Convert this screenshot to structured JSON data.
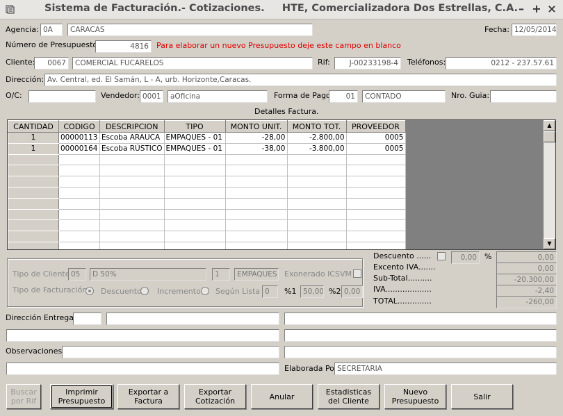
{
  "window": {
    "title": "Sistema de Facturación.- Cotizaciones.     HTE, Comercializadora Dos Estrellas, C.A.",
    "minimize": "–",
    "maximize": "+",
    "close": "×"
  },
  "header": {
    "agencia_label": "Agencia:",
    "agencia_code": "0A",
    "agencia_name": "CARACAS",
    "fecha_label": "Fecha:",
    "fecha": "12/05/2014",
    "presupuesto_label": "Número de Presupuesto:",
    "presupuesto": "4816",
    "presupuesto_hint": "Para elaborar un nuevo Presupuesto deje este campo en blanco",
    "cliente_label": "Cliente:",
    "cliente_code": "0067",
    "cliente_name": "COMERCIAL FUCARELOS",
    "rif_label": "Rif:",
    "rif": "J-00233198-4",
    "telefonos_label": "Teléfonos:",
    "telefonos": "0212 - 237.57.61",
    "direccion_label": "Dirección:",
    "direccion": "Av. Central, ed. El Samán, L - A, urb. Horizonte,Caracas.",
    "oc_label": "O/C:",
    "oc": "",
    "vendedor_label": "Vendedor:",
    "vendedor_code": "0001",
    "vendedor_name": "aOficina",
    "forma_pago_label": "Forma de Pago:",
    "forma_pago_code": "01",
    "forma_pago_name": "CONTADO",
    "nro_guia_label": "Nro. Guia:",
    "nro_guia": ""
  },
  "details": {
    "caption": "Detalles Factura.",
    "columns": [
      "CANTIDAD",
      "CODIGO",
      "DESCRIPCION",
      "TIPO",
      "MONTO UNIT.",
      "MONTO TOT.",
      "PROVEEDOR"
    ],
    "rows": [
      [
        "1",
        "00000113",
        "Escoba ARAUCA",
        "EMPAQUES - 01",
        "-28,00",
        "-2.800,00",
        "0005"
      ],
      [
        "1",
        "00000164",
        "Escoba RÚSTICO",
        "EMPAQUES - 01",
        "-38,00",
        "-3.800,00",
        "0005"
      ]
    ]
  },
  "tipo": {
    "tipo_cliente_label": "Tipo de Cliente:",
    "tipo_cliente_code": "05",
    "tipo_cliente_name": "D 50%",
    "tipo_code2": "1",
    "tipo_name2": "EMPAQUES",
    "exonerado_label": "Exonerado ICSVM",
    "tipo_fact_label": "Tipo de Facturación:",
    "descuento_label": "Descuento",
    "incremento_label": "Incremento",
    "segun_lista_label": "Según Lista",
    "segun_lista_value": "0",
    "pct1_label": "%1",
    "pct1": "50,00",
    "pct2_label": "%2",
    "pct2": "0,00"
  },
  "totals": {
    "descuento_label": "Descuento ......",
    "descuento_pct": "0,00",
    "pct_sign": "%",
    "descuento": "0,00",
    "excento_label": "Excento IVA.......",
    "excento": "0,00",
    "subtotal_label": "Sub-Total..........",
    "subtotal": "-20.300,00",
    "iva_label": "IVA...................",
    "iva": "-2,40",
    "total_label": "TOTAL..............",
    "total": "-260,00"
  },
  "footer": {
    "direccion_entrega_label": "Dirección Entrega:",
    "observaciones_label": "Observaciones:",
    "elaborada_label": "Elaborada Por:",
    "elaborada": "SECRETARIA"
  },
  "buttons": {
    "buscar": "Buscar por Rif",
    "imprimir": "Imprimir Presupuesto",
    "exportar_factura": "Exportar a Factura",
    "exportar_cotizacion": "Exportar Cotización",
    "anular": "Anular",
    "estadisticas": "Estadisticas del Cliente",
    "nuevo": "Nuevo Presupuesto",
    "salir": "Salir"
  }
}
